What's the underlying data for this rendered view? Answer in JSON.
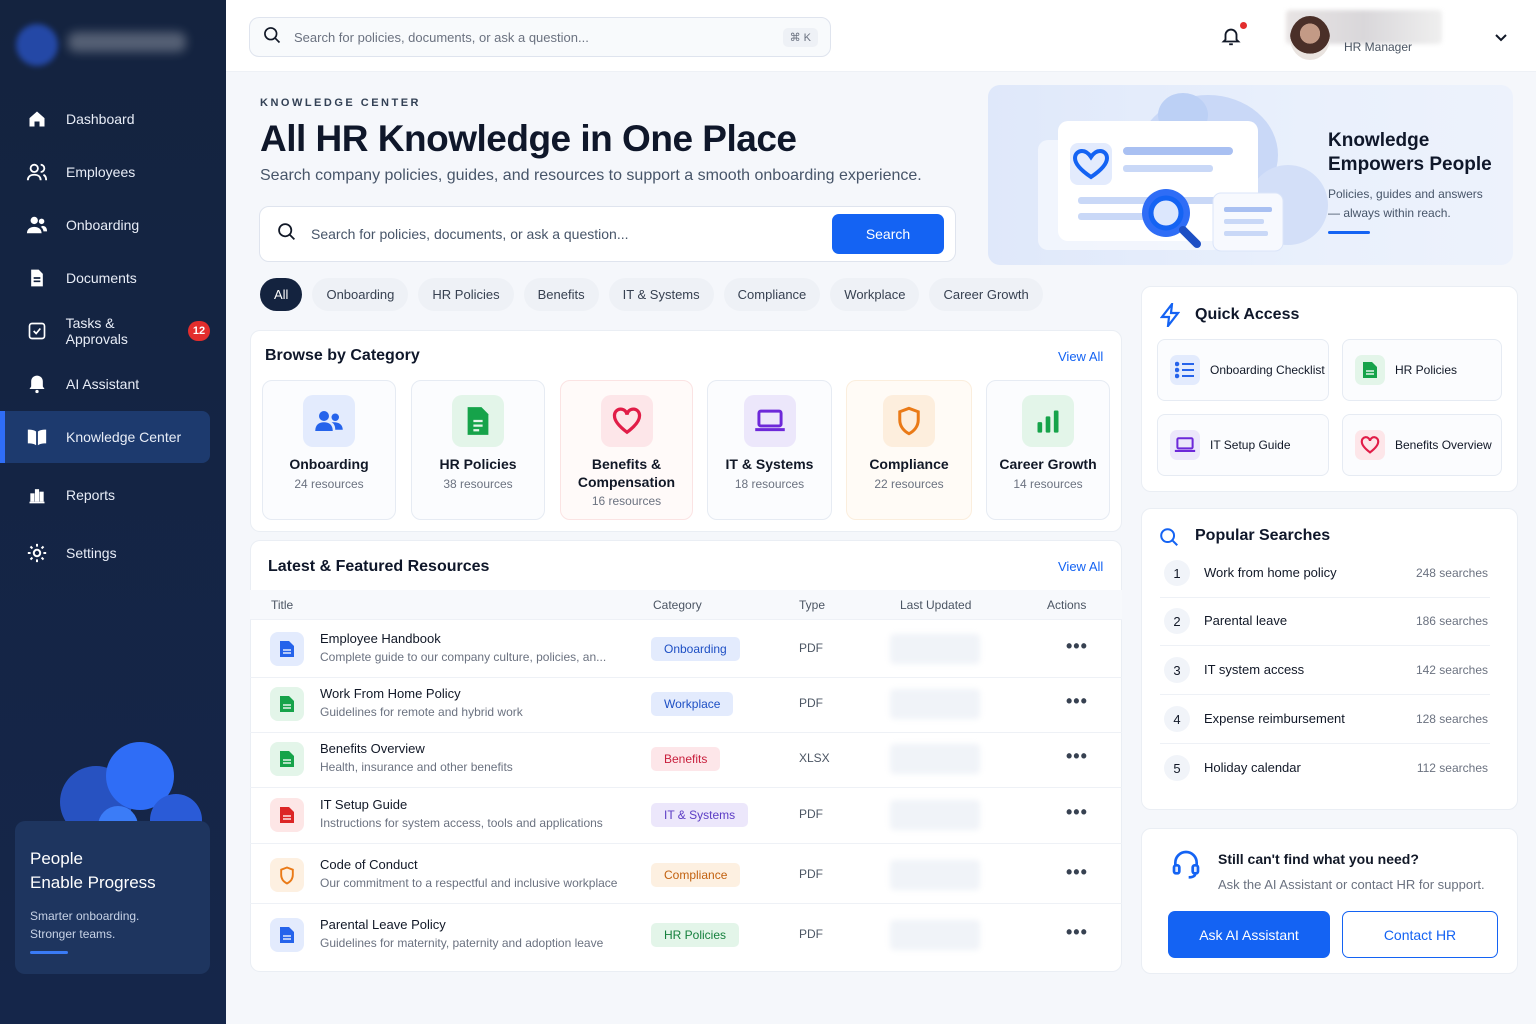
{
  "sidebar": {
    "items": [
      {
        "label": "Dashboard",
        "icon": "home-icon"
      },
      {
        "label": "Employees",
        "icon": "users-icon"
      },
      {
        "label": "Onboarding",
        "icon": "user-group-icon"
      },
      {
        "label": "Documents",
        "icon": "document-icon"
      },
      {
        "label": "Tasks & Approvals",
        "icon": "checkbox-icon",
        "badge": "12"
      },
      {
        "label": "AI Assistant",
        "icon": "ai-spark-icon"
      },
      {
        "label": "Knowledge Center",
        "icon": "book-open-icon",
        "active": true
      },
      {
        "label": "Reports",
        "icon": "bar-chart-icon"
      },
      {
        "label": "Settings",
        "icon": "gear-icon"
      }
    ],
    "promo": {
      "title_line1": "People",
      "title_line2": "Enable Progress",
      "sub_line1": "Smarter onboarding.",
      "sub_line2": "Stronger teams."
    }
  },
  "topbar": {
    "search_placeholder": "Search for policies, documents, or ask a question...",
    "shortcut": "⌘ K",
    "user_role": "HR Manager"
  },
  "hero": {
    "eyebrow": "KNOWLEDGE CENTER",
    "title": "All HR Knowledge in One Place",
    "subtitle": "Search company policies, guides, and resources to support a smooth onboarding experience.",
    "search_placeholder": "Search for policies, documents, or ask a question...",
    "search_button": "Search",
    "card_title_line1": "Knowledge",
    "card_title_line2": "Empowers People",
    "card_sub_line1": "Policies, guides and answers",
    "card_sub_line2": "— always within reach."
  },
  "filters": [
    "All",
    "Onboarding",
    "HR Policies",
    "Benefits",
    "IT & Systems",
    "Compliance",
    "Workplace",
    "Career Growth"
  ],
  "browse": {
    "title": "Browse by Category",
    "view_all": "View All",
    "categories": [
      {
        "name": "Onboarding",
        "count": "24 resources",
        "color": "#2563eb"
      },
      {
        "name": "HR Policies",
        "count": "38 resources",
        "color": "#16a34a"
      },
      {
        "name": "Benefits & Compensation",
        "count": "16 resources",
        "color": "#e11d48"
      },
      {
        "name": "IT & Systems",
        "count": "18 resources",
        "color": "#6d28d9"
      },
      {
        "name": "Compliance",
        "count": "22 resources",
        "color": "#ea7a17"
      },
      {
        "name": "Career Growth",
        "count": "14 resources",
        "color": "#16a34a"
      }
    ]
  },
  "resources": {
    "title": "Latest & Featured Resources",
    "view_all": "View All",
    "columns": [
      "Title",
      "Category",
      "Type",
      "Last Updated",
      "Actions"
    ],
    "rows": [
      {
        "title": "Employee Handbook",
        "desc": "Complete guide to our company culture, policies, an...",
        "category": "Onboarding",
        "type": "PDF",
        "actions": "•••"
      },
      {
        "title": "Work From Home Policy",
        "desc": "Guidelines for remote and hybrid work",
        "category": "Workplace",
        "type": "PDF",
        "actions": "•••"
      },
      {
        "title": "Benefits Overview",
        "desc": "Health, insurance and other benefits",
        "category": "Benefits",
        "type": "XLSX",
        "actions": "•••"
      },
      {
        "title": "IT Setup Guide",
        "desc": "Instructions for system access, tools and applications",
        "category": "IT & Systems",
        "type": "PDF",
        "actions": "•••"
      },
      {
        "title": "Code of Conduct",
        "desc": "Our commitment to a respectful and inclusive workplace",
        "category": "Compliance",
        "type": "PDF",
        "actions": "•••"
      },
      {
        "title": "Parental Leave Policy",
        "desc": "Guidelines for maternity, paternity and adoption leave",
        "category": "HR Policies",
        "type": "PDF",
        "actions": "•••"
      }
    ]
  },
  "quick_access": {
    "title": "Quick Access",
    "items": [
      "Onboarding Checklist",
      "HR Policies",
      "IT Setup Guide",
      "Benefits Overview"
    ]
  },
  "popular": {
    "title": "Popular Searches",
    "items": [
      {
        "num": "1",
        "text": "Work from home policy",
        "count": "248 searches"
      },
      {
        "num": "2",
        "text": "Parental leave",
        "count": "186 searches"
      },
      {
        "num": "3",
        "text": "IT system access",
        "count": "142 searches"
      },
      {
        "num": "4",
        "text": "Expense reimbursement",
        "count": "128 searches"
      },
      {
        "num": "5",
        "text": "Holiday calendar",
        "count": "112 searches"
      }
    ]
  },
  "help": {
    "title": "Still can't find what you need?",
    "subtitle": "Ask the AI Assistant or contact HR for support.",
    "primary": "Ask AI Assistant",
    "secondary": "Contact HR"
  },
  "colors": {
    "primary": "#1463f3",
    "sidebar": "#14233f",
    "badge": "#e32d2d"
  }
}
